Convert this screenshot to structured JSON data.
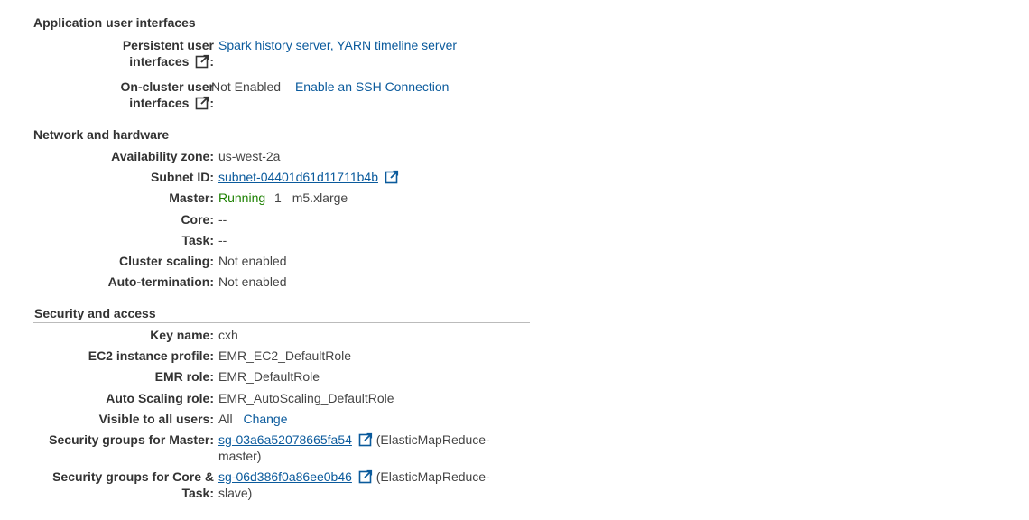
{
  "app_ui": {
    "title": "Application user interfaces",
    "persistent_label": "Persistent user interfaces",
    "persistent_label_l1": "Persistent user",
    "persistent_label_l2": "interfaces",
    "persistent_value": "Spark history server, YARN timeline server",
    "oncluster_label_l1": "On-cluster user",
    "oncluster_label_l2": "interfaces",
    "oncluster_status": "Not Enabled",
    "oncluster_link": "Enable an SSH Connection"
  },
  "network": {
    "title": "Network and hardware",
    "availability_zone_label": "Availability zone:",
    "availability_zone": "us-west-2a",
    "subnet_label": "Subnet ID:",
    "subnet_id": "subnet-04401d61d11711b4b",
    "master_label": "Master:",
    "master_status": "Running",
    "master_count": "1",
    "master_type": "m5.xlarge",
    "core_label": "Core:",
    "core_value": "--",
    "task_label": "Task:",
    "task_value": "--",
    "scaling_label": "Cluster scaling:",
    "scaling_value": "Not enabled",
    "autoterm_label": "Auto-termination:",
    "autoterm_value": "Not enabled"
  },
  "security": {
    "title": "Security and access",
    "key_name_label": "Key name:",
    "key_name": "cxh",
    "ec2_profile_label": "EC2 instance profile:",
    "ec2_profile": "EMR_EC2_DefaultRole",
    "emr_role_label": "EMR role:",
    "emr_role": "EMR_DefaultRole",
    "autoscaling_role_label": "Auto Scaling role:",
    "autoscaling_role": "EMR_AutoScaling_DefaultRole",
    "visible_label": "Visible to all users:",
    "visible_value": "All",
    "change_link": "Change",
    "sg_master_label": "Security groups for Master:",
    "sg_master_id": "sg-03a6a52078665fa54",
    "sg_master_name_l1": "(ElasticMapReduce-",
    "sg_master_name_l2": "master)",
    "sg_core_label_l1": "Security groups for Core &",
    "sg_core_label_l2": "Task:",
    "sg_core_id": "sg-06d386f0a86ee0b46",
    "sg_core_name_l1": "(ElasticMapReduce-",
    "sg_core_name_l2": "slave)"
  },
  "colors": {
    "link": "#0a5a9c",
    "running": "#1d8102"
  },
  "icons": {
    "external_link": "external-link-icon"
  }
}
